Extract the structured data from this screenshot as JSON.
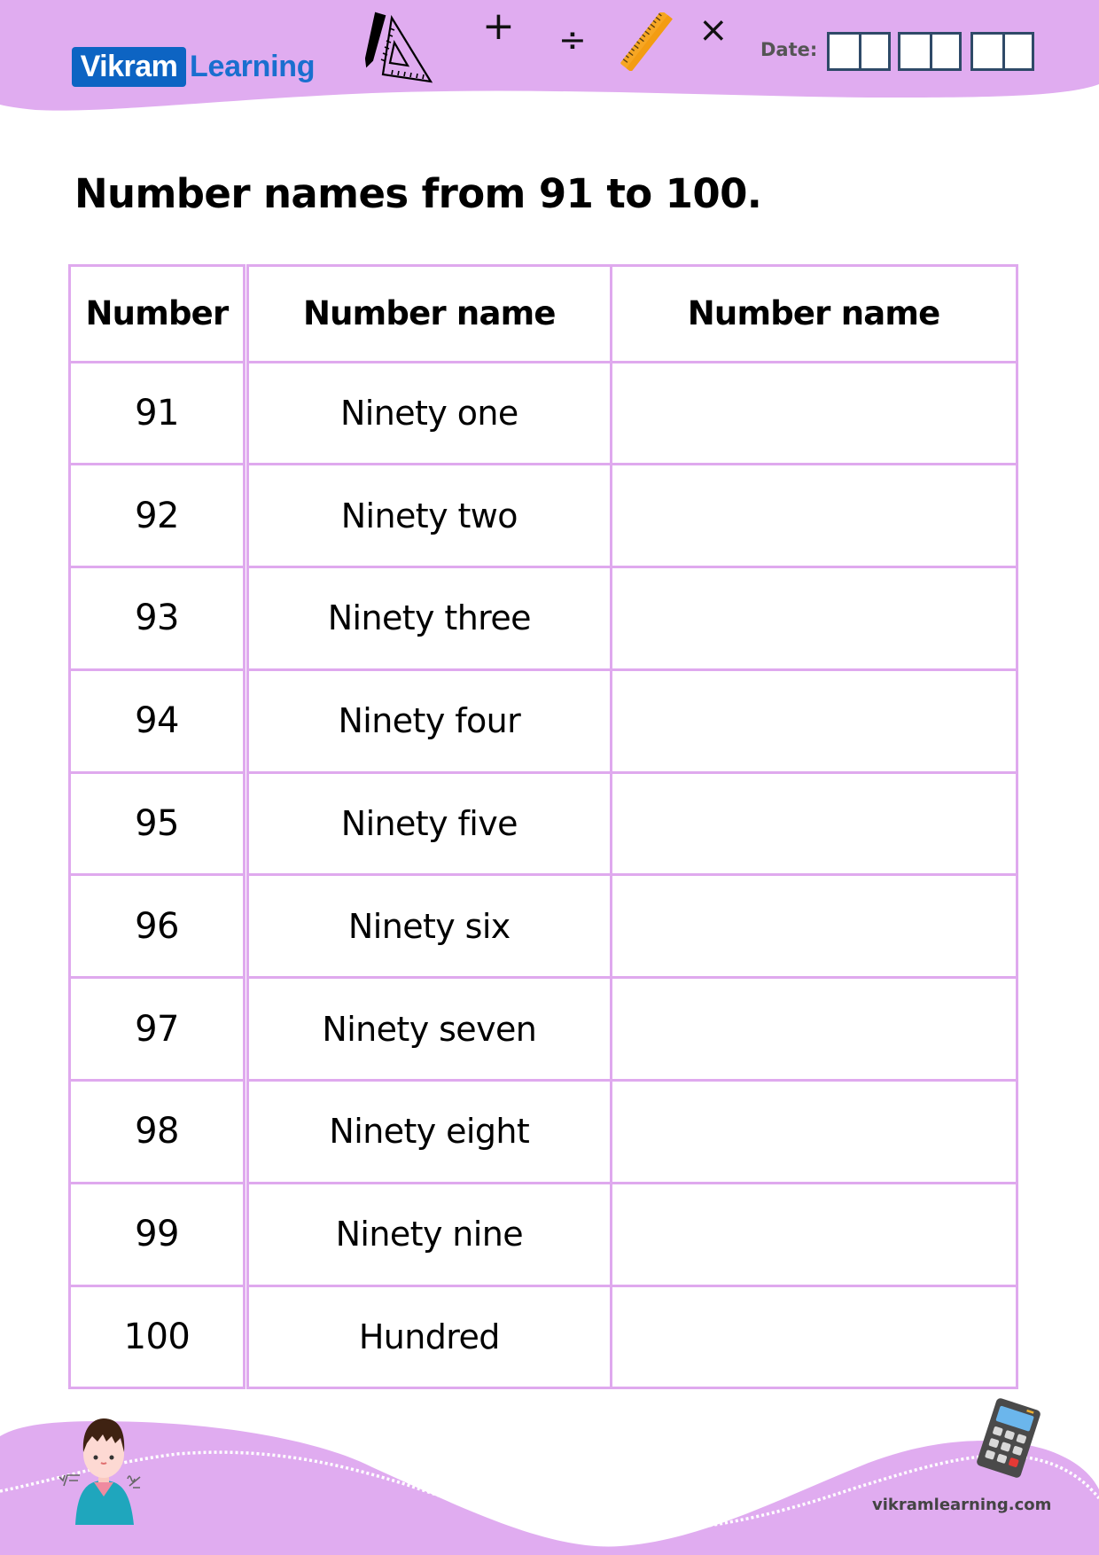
{
  "brand": {
    "logo_part1": "Vikram",
    "logo_part2": "Learning",
    "primary_color": "#0d64c3",
    "accent_color": "#e0acf0",
    "website": "vikramlearning.com"
  },
  "header": {
    "icons": [
      "pencil-set-square-icon",
      "plus-icon",
      "divide-icon",
      "ruler-icon",
      "times-icon"
    ],
    "plus_symbol": "+",
    "divide_symbol": "÷",
    "times_symbol": "×",
    "date_label": "Date:",
    "date_boxes": [
      "",
      "",
      "",
      "",
      "",
      ""
    ]
  },
  "worksheet": {
    "title": "Number names from 91 to 100.",
    "table": {
      "headers": [
        "Number",
        "Number name",
        "Number name"
      ],
      "rows": [
        {
          "number": "91",
          "name": "Ninety one",
          "answer": ""
        },
        {
          "number": "92",
          "name": "Ninety two",
          "answer": ""
        },
        {
          "number": "93",
          "name": "Ninety three",
          "answer": ""
        },
        {
          "number": "94",
          "name": "Ninety four",
          "answer": ""
        },
        {
          "number": "95",
          "name": "Ninety five",
          "answer": ""
        },
        {
          "number": "96",
          "name": "Ninety six",
          "answer": ""
        },
        {
          "number": "97",
          "name": "Ninety seven",
          "answer": ""
        },
        {
          "number": "98",
          "name": "Ninety eight",
          "answer": ""
        },
        {
          "number": "99",
          "name": "Ninety nine",
          "answer": ""
        },
        {
          "number": "100",
          "name": "Hundred",
          "answer": ""
        }
      ]
    }
  },
  "footer": {
    "illustrations": [
      "boy-with-math-formulas-illustration",
      "calculator-icon"
    ]
  }
}
